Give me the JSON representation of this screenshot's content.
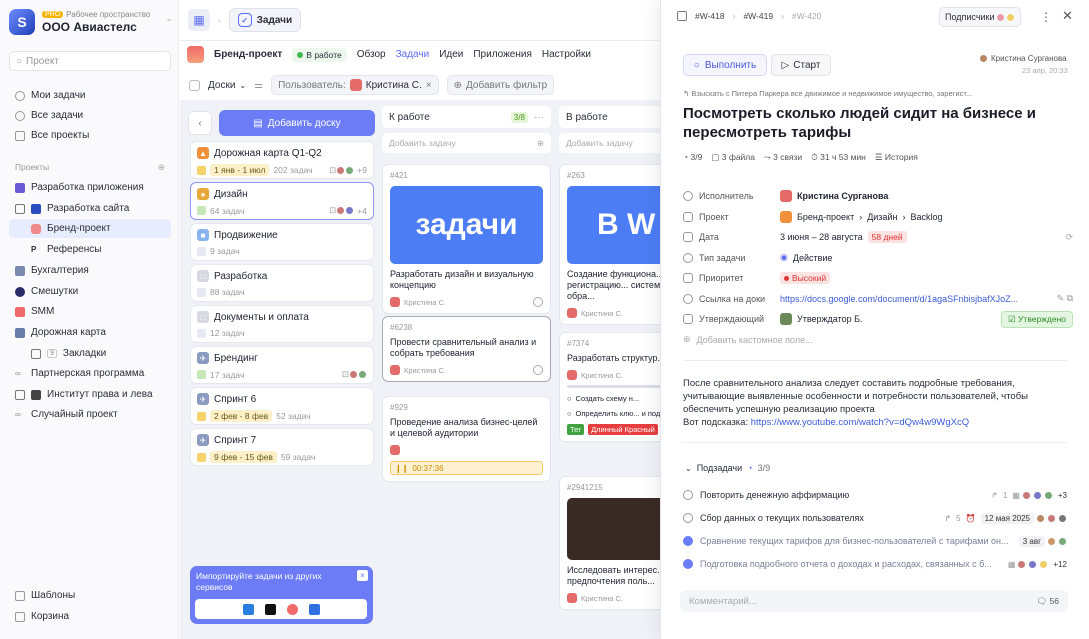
{
  "workspace": {
    "badge": "PRO",
    "label": "Рабочее пространство",
    "name": "ООО Авиастелс",
    "logo_letter": "S"
  },
  "sidebar": {
    "search_placeholder": "Проект",
    "nav": [
      "Мои задачи",
      "Все задачи",
      "Все проекты"
    ],
    "projects_label": "Проекты",
    "projects": [
      {
        "label": "Разработка приложения"
      },
      {
        "label": "Разработка сайта"
      },
      {
        "label": "Бренд-проект"
      },
      {
        "label": "Референсы"
      },
      {
        "label": "Бухгалтерия"
      },
      {
        "label": "Смешутки"
      },
      {
        "label": "SMM"
      },
      {
        "label": "Дорожная карта"
      },
      {
        "label": "Закладки"
      },
      {
        "label": "Партнерская программа"
      },
      {
        "label": "Институт права и лева"
      },
      {
        "label": "Случайный проект"
      }
    ],
    "bookmark_count": "9",
    "bottom": [
      "Шаблоны",
      "Корзина"
    ]
  },
  "topbar": {
    "tab": "Задачи"
  },
  "project": {
    "name": "Бренд-проект",
    "status": "В работе",
    "tabs": [
      "Обзор",
      "Задачи",
      "Идеи",
      "Приложения",
      "Настройки"
    ]
  },
  "filters": {
    "view": "Доски",
    "user_label": "Пользователь:",
    "user_value": "Кристина С.",
    "add_filter": "Добавить фильтр"
  },
  "boards": {
    "add_board": "Добавить доску",
    "items": [
      {
        "title": "Дорожная карта Q1-Q2",
        "date": "1 янв - 1 июл",
        "count": "202 задач",
        "extra": "+9"
      },
      {
        "title": "Дизайн",
        "count": "64 задач",
        "extra": "+4"
      },
      {
        "title": "Продвижение",
        "count": "9 задач"
      },
      {
        "title": "Разработка",
        "count": "88 задач"
      },
      {
        "title": "Документы и оплата",
        "count": "12 задач"
      },
      {
        "title": "Брендинг",
        "count": "17 задач"
      },
      {
        "title": "Спринт 6",
        "date": "2 фев - 8 фев",
        "count": "52 задач"
      },
      {
        "title": "Спринт 7",
        "date": "9 фев - 15 фев",
        "count": "59 задач"
      }
    ],
    "import_text": "Импортируйте задачи из других сервисов"
  },
  "kanban": {
    "col1": {
      "title": "К работе",
      "count": "3/8",
      "add": "Добавить задачу",
      "cards": [
        {
          "id": "#421",
          "image_text": "задачи",
          "title": "Разработать дизайн и визуальную концепцию",
          "user": "Кристина С."
        },
        {
          "id": "#6238",
          "title": "Провести сравнительный анализ и собрать требования",
          "user": "Кристина С."
        },
        {
          "id": "#929",
          "title": "Проведение анализа бизнес-целей и целевой аудитории",
          "timer": "00:37:36"
        }
      ]
    },
    "col2": {
      "title": "В работе",
      "add": "Добавить задачу",
      "cards": [
        {
          "id": "#263",
          "image_text": "В W",
          "title": "Создание функциона... включая регистрацию... систему, формы обра...",
          "user": "Кристина С."
        },
        {
          "id": "#7374",
          "title": "Разработать структур...",
          "user": "Кристина С.",
          "sub1": "Создать схему н...",
          "sub2": "Определить клю... и подразделы",
          "tag1": "Тег",
          "tag2": "Длинный Красный"
        },
        {
          "id": "#2941215",
          "title": "Исследовать интерес... и предпочтения поль...",
          "user": "Кристина С."
        }
      ]
    }
  },
  "panel": {
    "breadcrumb": [
      "#W-418",
      "#W-419",
      "#W-420"
    ],
    "subscribers": "Подписчики",
    "done_btn": "Выполнить",
    "start_btn": "Старт",
    "author": "Кристина Сурганова",
    "author_date": "23 апр, 20:33",
    "parent": "Взыскать с Питера Паркера все движимое и недвижимое имущество, зарегист...",
    "title": "Посмотреть сколько людей сидит на бизнесе и пересмотреть тарифы",
    "meta": [
      "3/9",
      "3 файла",
      "3 связи",
      "31 ч 53 мин",
      "История"
    ],
    "fields": {
      "assignee_label": "Исполнитель",
      "assignee": "Кристина Сурганова",
      "project_label": "Проект",
      "project": [
        "Бренд-проект",
        "Дизайн",
        "Backlog"
      ],
      "date_label": "Дата",
      "date": "3 июня – 28 августа",
      "days": "58 дней",
      "type_label": "Тип задачи",
      "type": "Действие",
      "priority_label": "Приоритет",
      "priority": "Высокий",
      "doc_label": "Ссылка на доки",
      "doc": "https://docs.google.com/document/d/1agaSFnbisjbafXJoZ...",
      "approver_label": "Утверждающий",
      "approver": "Утверждатор Б.",
      "approved": "Утверждено",
      "add_field": "Добавить кастомное поле..."
    },
    "description": "После сравнительного анализа следует составить подробные требования, учитывающие выявленные особенности и потребности пользователей, чтобы обеспечить успешную реализацию проекта",
    "hint_label": "Вот подсказка: ",
    "hint_link": "https://www.youtube.com/watch?v=dQw4w9WgXcQ",
    "subtasks_label": "Подзадачи",
    "subtasks_count": "3/9",
    "subtasks": [
      {
        "text": "Повторить денежную аффирмацию",
        "meta": "1",
        "extra": "+3"
      },
      {
        "text": "Сбор данных о текущих пользователях",
        "meta": "5",
        "date": "12 мая 2025"
      },
      {
        "text": "Сравнение текущих тарифов для бизнес-пользователей с тарифами он...",
        "date": "3 авг"
      },
      {
        "text": "Подготовка подробного отчета о доходах и расходах, связанных с б...",
        "extra": "+12"
      }
    ],
    "comment_placeholder": "Комментарий...",
    "comment_count": "56"
  },
  "colors": {
    "accent": "#6b7cf6",
    "danger": "#d33333",
    "success": "#2f8f2a"
  }
}
